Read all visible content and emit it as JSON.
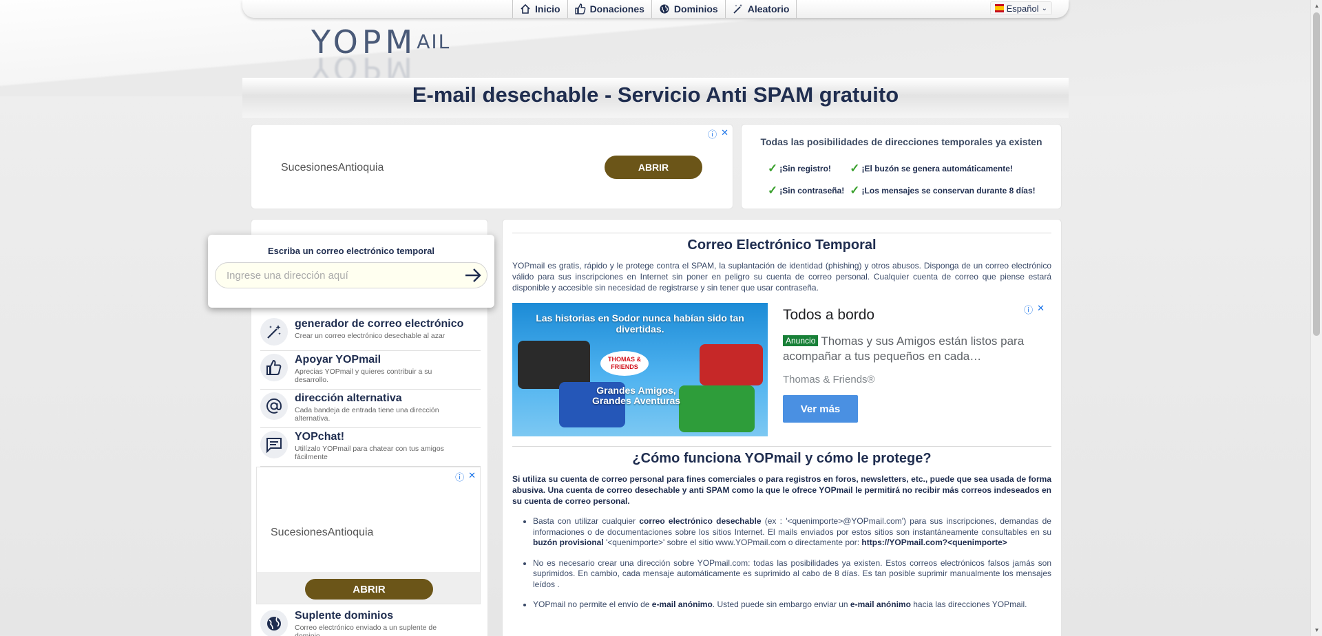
{
  "nav": {
    "items": [
      {
        "label": "Inicio",
        "icon": "home-icon"
      },
      {
        "label": "Donaciones",
        "icon": "thumbs-up-icon"
      },
      {
        "label": "Dominios",
        "icon": "globe-icon"
      },
      {
        "label": "Aleatorio",
        "icon": "magic-wand-icon"
      }
    ],
    "language": "Español"
  },
  "logo": {
    "text_main": "YOPM",
    "text_small": "AIL"
  },
  "title": "E-mail desechable - Servicio Anti SPAM gratuito",
  "ad_top": {
    "advertiser": "SucesionesAntioquia",
    "cta": "ABRIR",
    "info_icon": "ⓘ",
    "close_icon": "✕"
  },
  "features": {
    "heading": "Todas las posibilidades de direcciones temporales ya existen",
    "items": [
      "¡Sin registro!",
      "¡El buzón se genera automáticamente!",
      "¡Sin contraseña!",
      "¡Los mensajes se conservan durante 8 días!"
    ]
  },
  "search": {
    "label": "Escriba un correo electrónico temporal",
    "placeholder": "Ingrese una dirección aquí"
  },
  "menu": [
    {
      "title": "generador de correo electrónico",
      "subtitle": "Crear un correo electrónico desechable al azar"
    },
    {
      "title": "Apoyar YOPmail",
      "subtitle": "Aprecias YOPmail y quieres contribuir a su desarrollo."
    },
    {
      "title": "dirección alternativa",
      "subtitle": "Cada bandeja de entrada tiene una dirección alternativa."
    },
    {
      "title": "YOPchat!",
      "subtitle": "Utilízalo YOPmail para chatear con tus amigos fácilmente"
    }
  ],
  "ad_left": {
    "advertiser": "SucesionesAntioquia",
    "cta": "ABRIR"
  },
  "suplente": {
    "title": "Suplente dominios",
    "subtitle": "Correo electrónico enviado a un suplente de dominio"
  },
  "main": {
    "heading": "Correo Electrónico Temporal",
    "intro": "YOPmail es gratis, rápido y le protege contra el SPAM, la suplantación de identidad (phishing) y otros abusos. Disponga de un correo electrónico válido para sus inscripciones en Internet sin poner en peligro su cuenta de correo personal. Cualquier cuenta de correo que piense estará disponible y accesible sin necesidad de registrarse y sin tener que usar contraseña.",
    "ad": {
      "banner": "Las historias en Sodor nunca habían sido tan divertidas.",
      "badge": "THOMAS & FRIENDS",
      "tagline": "Grandes Amigos, Grandes Aventuras",
      "headline": "Todos a bordo",
      "tag": "Anuncio",
      "description": "Thomas y sus Amigos están listos para acompañar a tus pequeños en cada…",
      "advertiser": "Thomas & Friends®",
      "cta": "Ver más"
    },
    "heading2": "¿Cómo funciona YOPmail y cómo le protege?",
    "lead": "Si utiliza su cuenta de correo personal para fines comerciales o para registros en foros, newsletters, etc., puede que sea usada de forma abusiva. Una cuenta de correo desechable y anti SPAM como la que le ofrece YOPmail le permitirá no recibir más correos indeseados en su cuenta de correo personal.",
    "bullet1": {
      "a": "Basta con utilizar cualquier ",
      "b": "correo electrónico desechable",
      "c": " (ex : '<quenimporte>@YOPmail.com') para sus inscripciones, demandas de informaciones o de documentaciones sobre los sitios Internet. El mails enviados por estos sitios son instantáneamente consultables en su ",
      "d": "buzón provisional",
      "e": " '<quenimporte>' sobre el sitio www.YOPmail.com o directamente por: ",
      "f": "https://YOPmail.com?<quenimporte>"
    },
    "bullet2": "No es necesario crear una dirección sobre YOPmail.com: todas las posibilidades ya existen. Estos correos electrónicos falsos jamás son suprimidos. En cambio, cada mensaje automáticamente es suprimido al cabo de 8 días. Es tan posible suprimir manualmente los mensajes leídos .",
    "bullet3": {
      "a": "YOPmail no permite el envío de ",
      "b": "e-mail anónimo",
      "c": ". Usted puede sin embargo enviar un ",
      "d": "e-mail anónimo",
      "e": " hacia las direcciones YOPmail."
    }
  }
}
